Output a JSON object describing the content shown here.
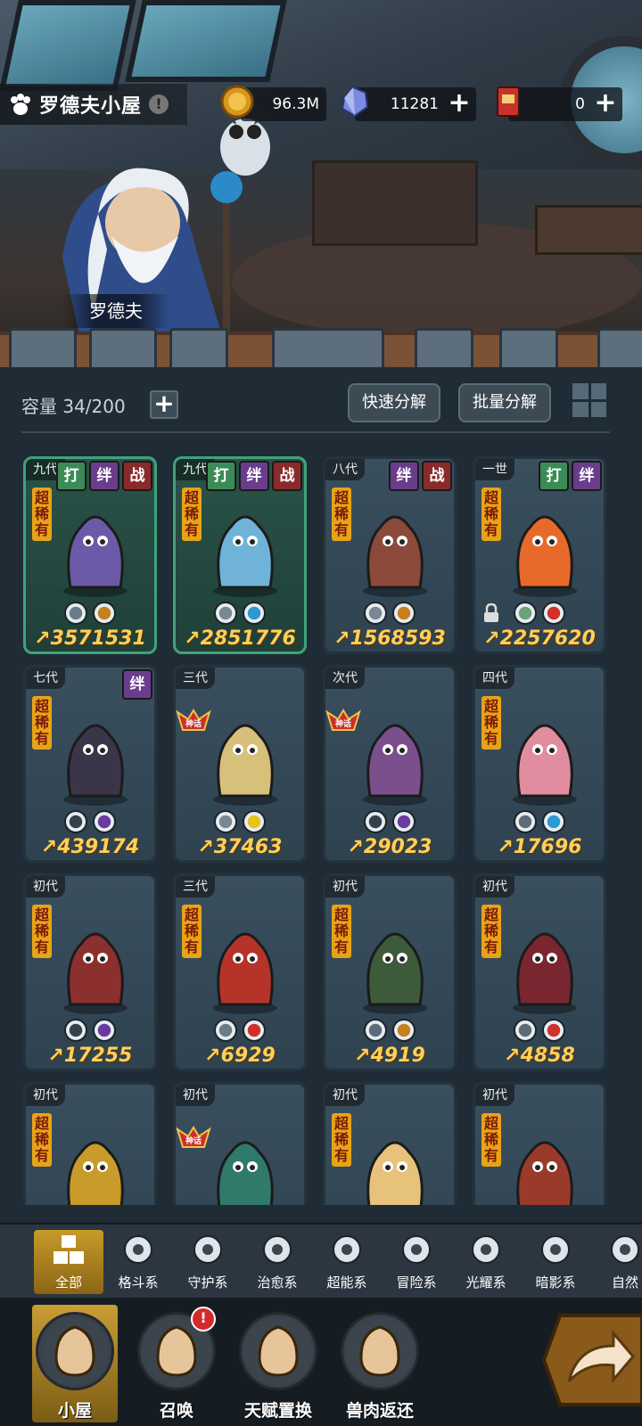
{
  "header": {
    "title": "罗德夫小屋",
    "warn_symbol": "!",
    "gold": "96.3M",
    "crystal": "11281",
    "ticket": "0",
    "plus": "+"
  },
  "hero": {
    "name": "罗德夫"
  },
  "storage": {
    "capacity_label": "容量 34/200",
    "plus": "+",
    "quick_decompose": "快速分解",
    "batch_decompose": "批量分解"
  },
  "cards": [
    {
      "gen": "九代",
      "rarity": "超稀有",
      "tags": [
        "打",
        "绊",
        "战"
      ],
      "elements": [
        "psychic",
        "adventure"
      ],
      "power": "3571531",
      "highlight": true,
      "locked": false,
      "myth": false,
      "color": "#6b5aa8"
    },
    {
      "gen": "九代",
      "rarity": "超稀有",
      "tags": [
        "打",
        "绊",
        "战"
      ],
      "elements": [
        "fight",
        "water"
      ],
      "power": "2851776",
      "highlight": true,
      "locked": false,
      "myth": false,
      "color": "#6fb3d8"
    },
    {
      "gen": "八代",
      "rarity": "超稀有",
      "tags": [
        "绊",
        "战"
      ],
      "elements": [
        "fight",
        "adventure"
      ],
      "power": "1568593",
      "highlight": false,
      "locked": false,
      "myth": false,
      "color": "#8b4a3a"
    },
    {
      "gen": "一世",
      "rarity": "超稀有",
      "tags": [
        "打",
        "绊"
      ],
      "elements": [
        "heal",
        "fire"
      ],
      "power": "2257620",
      "highlight": false,
      "locked": true,
      "myth": false,
      "color": "#e86a2a"
    },
    {
      "gen": "七代",
      "rarity": "超稀有",
      "tags": [
        "绊"
      ],
      "elements": [
        "shadow",
        "dark"
      ],
      "power": "439174",
      "highlight": false,
      "locked": false,
      "myth": false,
      "color": "#3a3548"
    },
    {
      "gen": "三代",
      "rarity": "",
      "tags": [],
      "elements": [
        "light",
        "star"
      ],
      "power": "37463",
      "highlight": false,
      "locked": false,
      "myth": true,
      "color": "#d7c07a"
    },
    {
      "gen": "次代",
      "rarity": "",
      "tags": [],
      "elements": [
        "shadow",
        "dark"
      ],
      "power": "29023",
      "highlight": false,
      "locked": false,
      "myth": true,
      "color": "#7a4f8c"
    },
    {
      "gen": "四代",
      "rarity": "超稀有",
      "tags": [],
      "elements": [
        "guard",
        "water"
      ],
      "power": "17696",
      "highlight": false,
      "locked": false,
      "myth": false,
      "color": "#e28ca0"
    },
    {
      "gen": "初代",
      "rarity": "超稀有",
      "tags": [],
      "elements": [
        "shadow",
        "dark"
      ],
      "power": "17255",
      "highlight": false,
      "locked": false,
      "myth": false,
      "color": "#8c2f2f"
    },
    {
      "gen": "三代",
      "rarity": "超稀有",
      "tags": [],
      "elements": [
        "psychic",
        "fire"
      ],
      "power": "6929",
      "highlight": false,
      "locked": false,
      "myth": false,
      "color": "#b6332a"
    },
    {
      "gen": "初代",
      "rarity": "超稀有",
      "tags": [],
      "elements": [
        "guard",
        "adventure"
      ],
      "power": "4919",
      "highlight": false,
      "locked": false,
      "myth": false,
      "color": "#3d5a3a"
    },
    {
      "gen": "初代",
      "rarity": "超稀有",
      "tags": [],
      "elements": [
        "guard",
        "fire"
      ],
      "power": "4858",
      "highlight": false,
      "locked": false,
      "myth": false,
      "color": "#7a2630"
    },
    {
      "gen": "初代",
      "rarity": "超稀有",
      "tags": [],
      "elements": [],
      "power": "",
      "highlight": false,
      "locked": false,
      "myth": false,
      "color": "#c99b2a"
    },
    {
      "gen": "初代",
      "rarity": "",
      "tags": [],
      "elements": [],
      "power": "",
      "highlight": false,
      "locked": false,
      "myth": true,
      "color": "#2f7a6a"
    },
    {
      "gen": "初代",
      "rarity": "超稀有",
      "tags": [],
      "elements": [],
      "power": "",
      "highlight": false,
      "locked": false,
      "myth": false,
      "color": "#e7c27a"
    },
    {
      "gen": "初代",
      "rarity": "超稀有",
      "tags": [],
      "elements": [],
      "power": "",
      "highlight": false,
      "locked": false,
      "myth": false,
      "color": "#9a3a2a"
    }
  ],
  "myth_label": "神话",
  "filters": [
    {
      "label": "全部",
      "icon": "all-icon",
      "active": true
    },
    {
      "label": "格斗系",
      "icon": "fist-icon",
      "active": false
    },
    {
      "label": "守护系",
      "icon": "shield-icon",
      "active": false
    },
    {
      "label": "治愈系",
      "icon": "sprout-icon",
      "active": false
    },
    {
      "label": "超能系",
      "icon": "alien-icon",
      "active": false
    },
    {
      "label": "冒险系",
      "icon": "lantern-icon",
      "active": false
    },
    {
      "label": "光耀系",
      "icon": "compass-star-icon",
      "active": false
    },
    {
      "label": "暗影系",
      "icon": "eye-icon",
      "active": false
    },
    {
      "label": "自然",
      "icon": "leaf-icon",
      "active": false
    }
  ],
  "nav": [
    {
      "label": "小屋",
      "icon": "house-icon",
      "active": true
    },
    {
      "label": "召唤",
      "icon": "egg-icon",
      "active": false
    },
    {
      "label": "天赋置换",
      "icon": "swap-icon",
      "active": false
    },
    {
      "label": "兽肉返还",
      "icon": "meat-icon",
      "active": false
    }
  ],
  "badge": "!",
  "colors": {
    "gold": "#ffcf5a",
    "rarity": "#e7a417",
    "green_border": "#3fa37a"
  }
}
